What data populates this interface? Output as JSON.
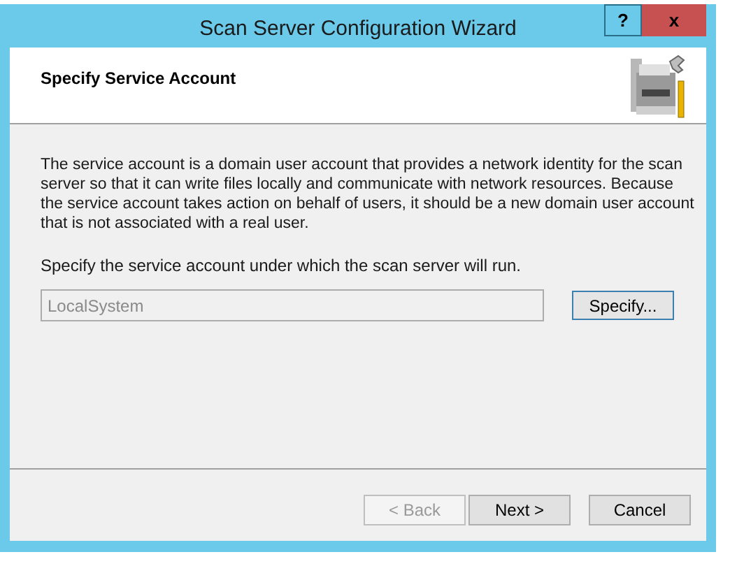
{
  "window": {
    "title": "Scan Server Configuration Wizard",
    "help_button": "?",
    "close_button": "x"
  },
  "header": {
    "title": "Specify Service Account"
  },
  "description": "The service account is a domain user account that provides a network identity for the scan server so that it can write files locally and communicate with network resources. Because the service account takes action on behalf of users, it should be a new domain user account that is not associated with a real user.",
  "account": {
    "label": "Specify the service account under which the scan server will run.",
    "value": "LocalSystem",
    "disabled": true,
    "button": "Specify..."
  },
  "buttons": [
    {
      "label": "< Back",
      "disabled": true
    },
    {
      "label": "Next >",
      "disabled": false
    },
    {
      "label": "Cancel",
      "disabled": false
    }
  ]
}
